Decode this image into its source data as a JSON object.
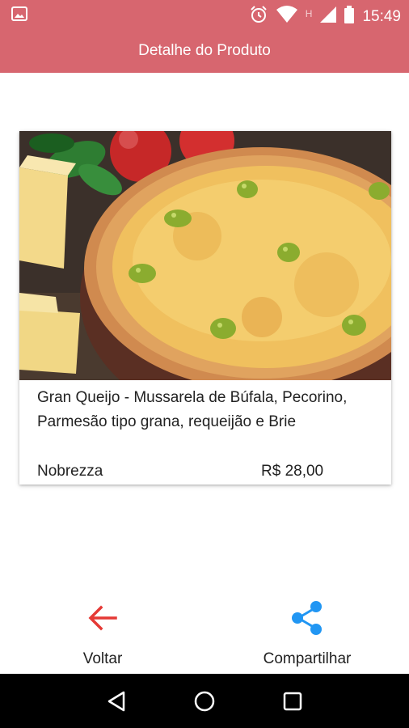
{
  "status_bar": {
    "time": "15:49",
    "network_letter": "H",
    "icons": [
      "image-icon",
      "alarm-icon",
      "wifi-icon",
      "signal-icon",
      "battery-icon"
    ]
  },
  "app_bar": {
    "title": "Detalhe do Produto",
    "color": "#d7666f"
  },
  "product": {
    "image_icon": "pizza-photo",
    "title": "Gran Queijo - Mussarela de Búfala, Pecorino, Parmesão tipo grana, requeijão e Brie",
    "store": "Nobrezza",
    "price": "R$ 28,00"
  },
  "actions": {
    "back": {
      "label": "Voltar",
      "icon": "arrow-left-icon",
      "color": "#e53935"
    },
    "share": {
      "label": "Compartilhar",
      "icon": "share-icon",
      "color": "#2196f3"
    }
  },
  "nav_bar": {
    "icons": [
      "back-triangle-icon",
      "home-circle-icon",
      "recents-square-icon"
    ]
  }
}
